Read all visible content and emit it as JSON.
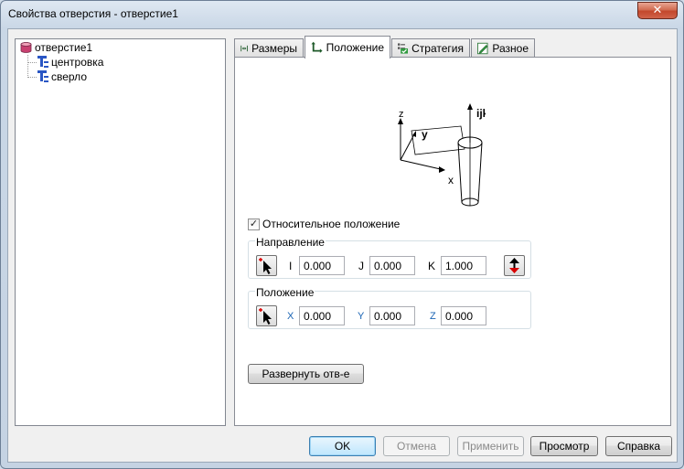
{
  "window": {
    "title": "Свойства отверстия - отверстие1",
    "close_label": "✕"
  },
  "tree": {
    "root": "отверстие1",
    "children": [
      "центровка",
      "сверло"
    ]
  },
  "tabs": [
    {
      "label": "Размеры",
      "icon": "dimensions-icon"
    },
    {
      "label": "Положение",
      "icon": "position-icon"
    },
    {
      "label": "Стратегия",
      "icon": "strategy-icon"
    },
    {
      "label": "Разное",
      "icon": "misc-icon"
    }
  ],
  "active_tab": "Положение",
  "diagram": {
    "z": "z",
    "y": "y",
    "x": "x",
    "ijk": "ijk"
  },
  "relative_position": {
    "label": "Относительное положение",
    "checked": true
  },
  "direction": {
    "label": "Направление",
    "i_label": "I",
    "i_value": "0.000",
    "j_label": "J",
    "j_value": "0.000",
    "k_label": "K",
    "k_value": "1.000"
  },
  "position": {
    "label": "Положение",
    "x_label": "X",
    "x_value": "0.000",
    "y_label": "Y",
    "y_value": "0.000",
    "z_label": "Z",
    "z_value": "0.000"
  },
  "reverse_button": "Развернуть отв-е",
  "buttons": {
    "ok": "OK",
    "cancel": "Отмена",
    "apply": "Применить",
    "preview": "Просмотр",
    "help": "Справка"
  }
}
